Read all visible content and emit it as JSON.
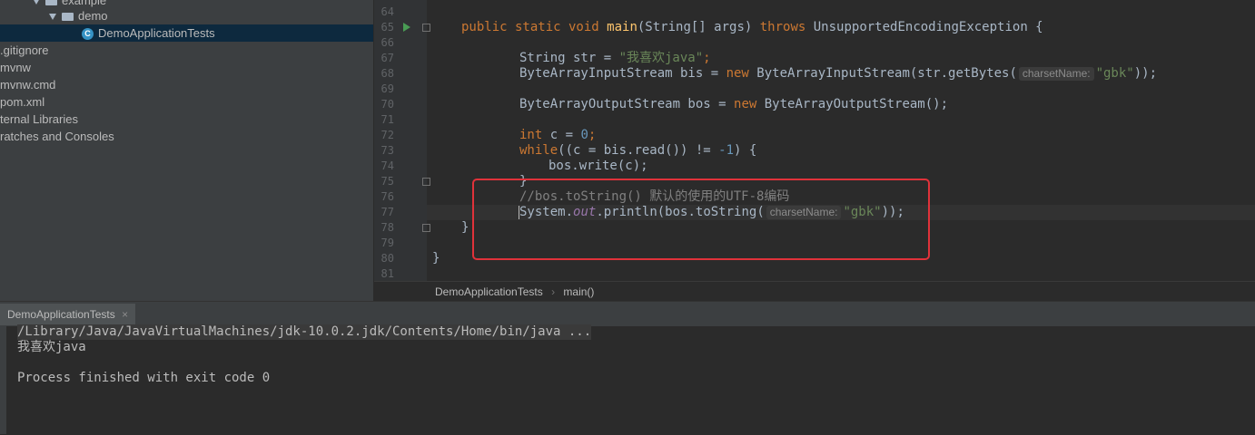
{
  "project_tree": {
    "items": [
      {
        "label": "example",
        "kind": "folder-partial"
      },
      {
        "label": "demo",
        "kind": "folder"
      },
      {
        "label": "DemoApplicationTests",
        "kind": "class"
      },
      {
        "label": ".gitignore",
        "kind": "file"
      },
      {
        "label": "mvnw",
        "kind": "file"
      },
      {
        "label": "mvnw.cmd",
        "kind": "file"
      },
      {
        "label": "pom.xml",
        "kind": "file"
      },
      {
        "label": "ternal Libraries",
        "kind": "node"
      },
      {
        "label": "ratches and Consoles",
        "kind": "node"
      }
    ]
  },
  "editor": {
    "line_numbers": [
      "64",
      "65",
      "66",
      "67",
      "68",
      "69",
      "70",
      "71",
      "72",
      "73",
      "74",
      "75",
      "76",
      "77",
      "78",
      "79",
      "80",
      "81"
    ],
    "lines": {
      "l65_kw1": "public static void ",
      "l65_fn": "main",
      "l65_a": "(String[] args) ",
      "l65_kw2": "throws ",
      "l65_b": "UnsupportedEncodingException {",
      "l67_a": "String str = ",
      "l67_str": "\"我喜欢java\"",
      "l67_semi": ";",
      "l68_a": "ByteArrayInputStream bis = ",
      "l68_kw": "new ",
      "l68_b": "ByteArrayInputStream(str.getBytes(",
      "l68_str": "\"gbk\"",
      "l68_c": "));",
      "l70_a": "ByteArrayOutputStream bos = ",
      "l70_kw": "new ",
      "l70_b": "ByteArrayOutputStream();",
      "l72_kw": "int ",
      "l72_a": "c = ",
      "l72_num": "0",
      "l72_semi": ";",
      "l73_kw": "while",
      "l73_a": "((c = bis.read()) != ",
      "l73_num": "-1",
      "l73_b": ") {",
      "l74": "bos.write(c);",
      "l75": "}",
      "l76_cmt": "//bos.toString() 默认的使用的UTF-8编码",
      "l77_a": "System.",
      "l77_stat": "out",
      "l77_b": ".println(bos.toString(",
      "l77_str": "\"gbk\"",
      "l77_c": "));",
      "l78": "}",
      "l80": "}"
    },
    "param_hint": "charsetName:"
  },
  "breadcrumb": {
    "items": [
      "DemoApplicationTests",
      "main()"
    ],
    "separator": "›"
  },
  "run_panel": {
    "tab_label": "DemoApplicationTests",
    "close_glyph": "×",
    "output": [
      "/Library/Java/JavaVirtualMachines/jdk-10.0.2.jdk/Contents/Home/bin/java ...",
      "我喜欢java",
      "",
      "Process finished with exit code 0"
    ]
  },
  "colors": {
    "keyword": "#cc7832",
    "string": "#6a8759",
    "function": "#ffc66d",
    "number": "#6897bb",
    "annotation_box": "#e0323a"
  }
}
